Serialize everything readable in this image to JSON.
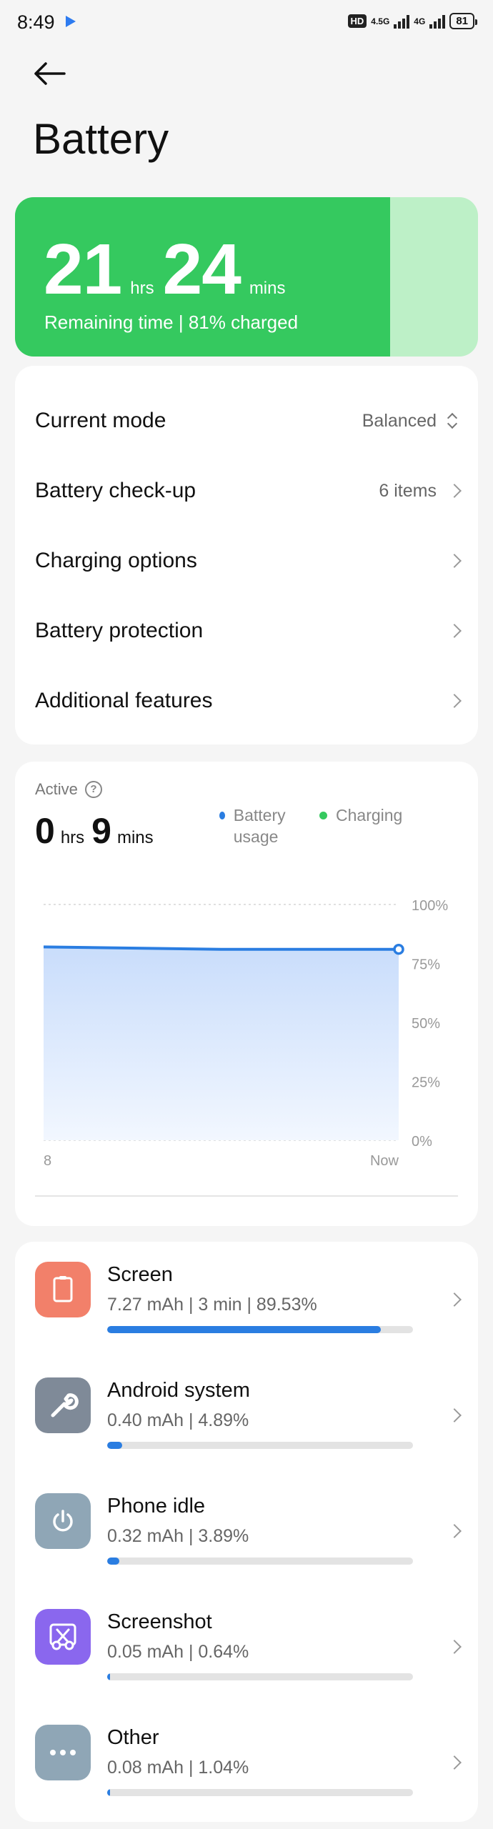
{
  "status_bar": {
    "time": "8:49",
    "hd_label": "HD",
    "network_1": "4.5G",
    "network_2": "4G",
    "battery_level": "81",
    "play_store_icon": "play-store-icon"
  },
  "header": {
    "back_icon": "arrow-left-icon",
    "title": "Battery"
  },
  "hero": {
    "hours_value": "21",
    "hours_unit": "hrs",
    "minutes_value": "24",
    "minutes_unit": "mins",
    "subtitle": "Remaining time | 81% charged",
    "charge_fraction": 0.81,
    "colors": {
      "fill": "#35c95f",
      "empty": "#bdf0c7"
    }
  },
  "settings": [
    {
      "label": "Current mode",
      "value": "Balanced",
      "icon": "up-down-icon"
    },
    {
      "label": "Battery check-up",
      "value": "6 items",
      "icon": "chevron-right-icon"
    },
    {
      "label": "Charging options",
      "value": "",
      "icon": "chevron-right-icon"
    },
    {
      "label": "Battery protection",
      "value": "",
      "icon": "chevron-right-icon"
    },
    {
      "label": "Additional features",
      "value": "",
      "icon": "chevron-right-icon"
    }
  ],
  "usage": {
    "active_label": "Active",
    "help_icon": "question-circle-icon",
    "hours_value": "0",
    "hours_unit": "hrs",
    "minutes_value": "9",
    "minutes_unit": "mins",
    "legend": [
      {
        "label": "Battery usage",
        "color": "#2a7de1"
      },
      {
        "label": "Charging",
        "color": "#35c95f"
      }
    ]
  },
  "chart_data": {
    "type": "area",
    "x": [
      "8",
      "",
      "Now"
    ],
    "x_tick_labels": [
      "8",
      "Now"
    ],
    "series": [
      {
        "name": "Battery usage",
        "values": [
          82,
          81,
          81
        ]
      }
    ],
    "y_tick_labels": [
      "100%",
      "75%",
      "50%",
      "25%",
      "0%"
    ],
    "ylim": [
      0,
      100
    ],
    "grid": true,
    "colors": {
      "line": "#2a7de1",
      "area_top": "#c9ddfb",
      "area_bottom": "#f2f7ff"
    }
  },
  "apps": [
    {
      "name": "Screen",
      "stats": "7.27 mAh | 3 min  | 89.53%",
      "share": 89.53,
      "icon": "phone-screen-icon",
      "color": "#f2806a"
    },
    {
      "name": "Android system",
      "stats": "0.40 mAh | 4.89%",
      "share": 4.89,
      "icon": "wrench-icon",
      "color": "#7f8a98"
    },
    {
      "name": "Phone idle",
      "stats": "0.32 mAh | 3.89%",
      "share": 3.89,
      "icon": "power-icon",
      "color": "#8fa6b6"
    },
    {
      "name": "Screenshot",
      "stats": "0.05 mAh | 0.64%",
      "share": 0.64,
      "icon": "scissors-icon",
      "color": "#8a67ee"
    },
    {
      "name": "Other",
      "stats": "0.08 mAh | 1.04%",
      "share": 1.04,
      "icon": "more-dots-icon",
      "color": "#8fa6b6"
    }
  ]
}
